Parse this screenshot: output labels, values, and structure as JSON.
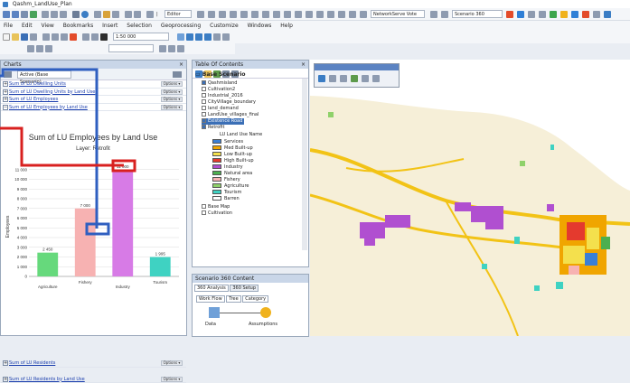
{
  "window": {
    "title": "Qashm_LandUse_Plan"
  },
  "menu": [
    "File",
    "Edit",
    "View",
    "Bookmarks",
    "Insert",
    "Selection",
    "Geoprocessing",
    "Customize",
    "Windows",
    "Help"
  ],
  "toolbar": {
    "scale": "1:50 000",
    "editor_label": "Editor",
    "network_label": "NetworkServe Vote",
    "scenario_label": "Scenario 360"
  },
  "charts_panel": {
    "title": "Charts",
    "close": "×",
    "active_scenario": "Active (Base Scenario)",
    "items": [
      {
        "label": "Sum of LU Dwelling Units",
        "expanded": false
      },
      {
        "label": "Sum of LU Dwelling Units by Land Use",
        "expanded": false
      },
      {
        "label": "Sum of LU Employees",
        "expanded": false
      },
      {
        "label": "Sum of LU Employees by Land Use",
        "expanded": true
      }
    ],
    "bottom_items": [
      {
        "label": "Sum of LU Residents"
      },
      {
        "label": "Sum of LU Residents by Land Use"
      }
    ],
    "options_label": "Options ▾"
  },
  "chart_data": {
    "type": "bar",
    "title": "Sum of LU Employees by Land Use",
    "subtitle": "Layer: Retrofit",
    "xlabel": "",
    "ylabel": "Employees",
    "categories": [
      "Agriculture",
      "Fishery",
      "Industry",
      "Tourism"
    ],
    "values": [
      2450,
      7000,
      11000,
      1995
    ],
    "value_labels": [
      "2 450",
      "7 000",
      "11 000",
      "1 995"
    ],
    "colors": [
      "#66d97c",
      "#f7b2b2",
      "#d77be6",
      "#3fd2c2"
    ],
    "ylim": [
      0,
      12000
    ],
    "yticks": [
      0,
      1000,
      2000,
      3000,
      4000,
      5000,
      6000,
      7000,
      8000,
      9000,
      10000,
      11000
    ],
    "ytick_labels": [
      "0",
      "1 000",
      "2 000",
      "3 000",
      "4 000",
      "5 000",
      "6 000",
      "7 000",
      "8 000",
      "9 000",
      "10 000",
      "11 000"
    ],
    "grid": true,
    "legend": "none"
  },
  "toc": {
    "title": "Table Of Contents",
    "close": "× ",
    "root": "Base Scenario",
    "layers": [
      "Qashmisland",
      "Cultivation2",
      "Industrial_2016",
      "CityVillage_boundary",
      "land_demand",
      "LandUse_villages_final",
      "Existence Road",
      "Retrofit"
    ],
    "legend_title": "LU Land Use Name",
    "legend": [
      {
        "label": "Services",
        "color": "#3a7fd6"
      },
      {
        "label": "Med Built-up",
        "color": "#f0a500"
      },
      {
        "label": "Low Built-up",
        "color": "#f4e04d"
      },
      {
        "label": "High Built-up",
        "color": "#e43a2e"
      },
      {
        "label": "Industry",
        "color": "#b04fd0"
      },
      {
        "label": "Natural area",
        "color": "#4caf50"
      },
      {
        "label": "Fishery",
        "color": "#f7b2b2"
      },
      {
        "label": "Agriculture",
        "color": "#8fd16a"
      },
      {
        "label": "Tourism",
        "color": "#3fd2c2"
      },
      {
        "label": "Barren",
        "color": "#ffffff"
      }
    ],
    "after": [
      "Base Map",
      "Cultivation"
    ]
  },
  "scenario360": {
    "title": "Scenario 360 Content",
    "tabs": [
      "360 Analysis",
      "360 Setup"
    ],
    "subtabs": [
      "Work Flow",
      "Tree",
      "Category"
    ],
    "nodes": [
      "Data",
      "Assumptions"
    ]
  }
}
